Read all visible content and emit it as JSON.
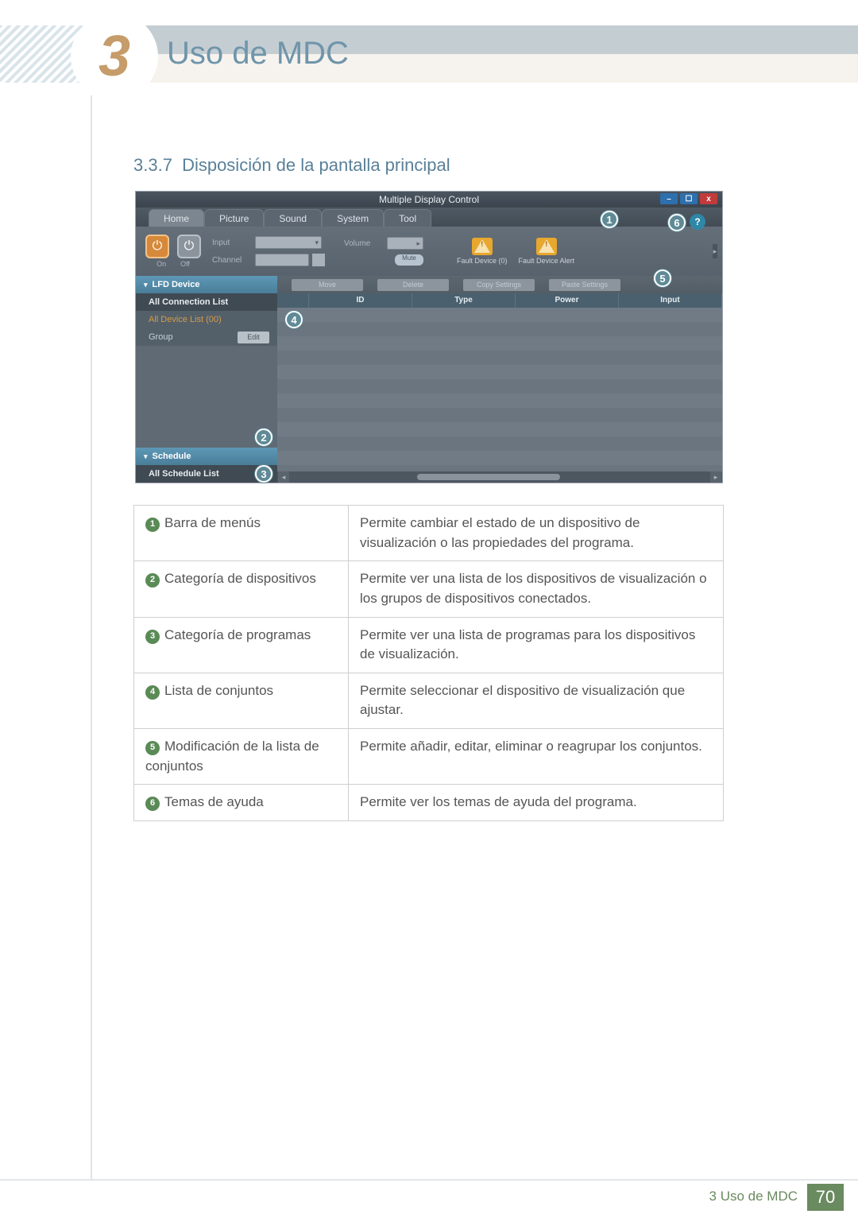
{
  "chapter": {
    "number": "3",
    "title": "Uso de MDC"
  },
  "section": {
    "number": "3.3.7",
    "title": "Disposición de la pantalla principal"
  },
  "screenshot": {
    "window_title": "Multiple Display Control",
    "win_buttons": {
      "min": "–",
      "max": "☐",
      "close": "x"
    },
    "menu": [
      "Home",
      "Picture",
      "Sound",
      "System",
      "Tool"
    ],
    "toolbar": {
      "on": "On",
      "off": "Off",
      "input_lbl": "Input",
      "channel_lbl": "Channel",
      "volume_lbl": "Volume",
      "mute": "Mute",
      "fault1": "Fault Device (0)",
      "fault2": "Fault Device Alert"
    },
    "left": {
      "lfd": "LFD Device",
      "all_conn": "All Connection List",
      "all_dev": "All Device List (00)",
      "group": "Group",
      "edit": "Edit",
      "schedule": "Schedule",
      "all_sched": "All Schedule List"
    },
    "right": {
      "btns": [
        "Move",
        "Delete",
        "Copy Settings",
        "Paste Settings"
      ],
      "cols": [
        "ID",
        "Type",
        "Power",
        "Input"
      ]
    }
  },
  "callouts": [
    "1",
    "2",
    "3",
    "4",
    "5",
    "6"
  ],
  "help_badge": "?",
  "table": [
    {
      "n": "1",
      "label": "Barra de menús",
      "desc": "Permite cambiar el estado de un dispositivo de visualización o las propiedades del programa."
    },
    {
      "n": "2",
      "label": "Categoría de dispositivos",
      "desc": "Permite ver una lista de los dispositivos de visualización o los grupos de dispositivos conectados."
    },
    {
      "n": "3",
      "label": "Categoría de programas",
      "desc": "Permite ver una lista de programas para los dispositivos de visualización."
    },
    {
      "n": "4",
      "label": "Lista de conjuntos",
      "desc": "Permite seleccionar el dispositivo de visualización que ajustar."
    },
    {
      "n": "5",
      "label": "Modificación de la lista de conjuntos",
      "desc": "Permite añadir, editar, eliminar o reagrupar los conjuntos."
    },
    {
      "n": "6",
      "label": "Temas de ayuda",
      "desc": "Permite ver los temas de ayuda del programa."
    }
  ],
  "footer": {
    "text": "3 Uso de MDC",
    "page": "70"
  }
}
